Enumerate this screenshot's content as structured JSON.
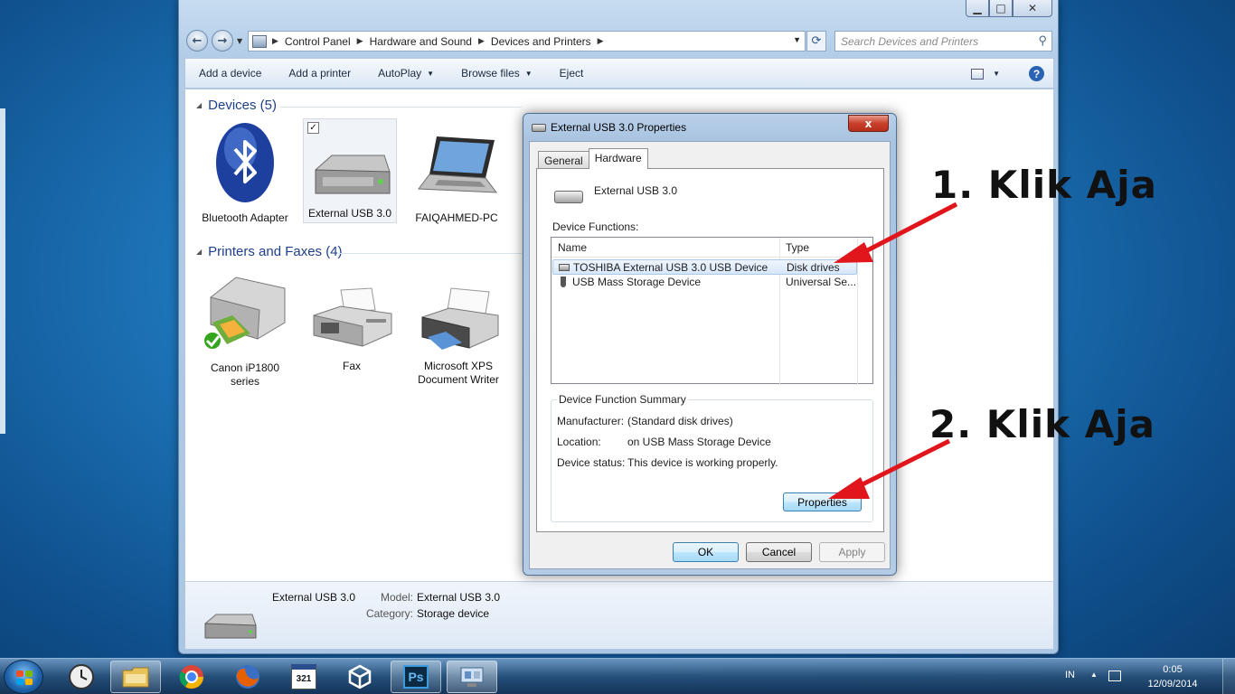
{
  "explorer": {
    "address": {
      "crumbs": [
        "Control Panel",
        "Hardware and Sound",
        "Devices and Printers"
      ]
    },
    "search_placeholder": "Search Devices and Printers",
    "toolbar": {
      "add_device": "Add a device",
      "add_printer": "Add a printer",
      "autoplay": "AutoPlay",
      "browse_files": "Browse files",
      "eject": "Eject"
    },
    "groups": {
      "devices": {
        "title": "Devices (5)",
        "items": [
          {
            "label": "Bluetooth Adapter",
            "icon": "bluetooth-icon"
          },
          {
            "label": "External USB 3.0",
            "icon": "external-drive-icon",
            "selected": true
          },
          {
            "label": "FAIQAHMED-PC",
            "icon": "laptop-icon"
          }
        ]
      },
      "printers": {
        "title": "Printers and Faxes (4)",
        "items": [
          {
            "label": "Canon iP1800 series",
            "icon": "printer-icon",
            "default": true
          },
          {
            "label": "Fax",
            "icon": "fax-icon"
          },
          {
            "label": "Microsoft XPS Document Writer",
            "icon": "printer-icon"
          }
        ]
      }
    },
    "details": {
      "name": "External USB 3.0",
      "model_label": "Model:",
      "model_value": "External USB 3.0",
      "category_label": "Category:",
      "category_value": "Storage device"
    }
  },
  "dialog": {
    "title": "External USB 3.0 Properties",
    "close": "x",
    "tabs": [
      "General",
      "Hardware"
    ],
    "device_name": "External USB 3.0",
    "functions_label": "Device Functions:",
    "columns": [
      "Name",
      "Type"
    ],
    "rows": [
      {
        "name": "TOSHIBA External USB 3.0 USB Device",
        "type": "Disk drives",
        "selected": true
      },
      {
        "name": "USB Mass Storage Device",
        "type": "Universal Se..."
      }
    ],
    "summary": {
      "legend": "Device Function Summary",
      "manufacturer_label": "Manufacturer:",
      "manufacturer_value": "(Standard disk drives)",
      "location_label": "Location:",
      "location_value": "on USB Mass Storage Device",
      "status_label": "Device status:",
      "status_value": "This device is working properly.",
      "properties_button": "Properties"
    },
    "buttons": {
      "ok": "OK",
      "cancel": "Cancel",
      "apply": "Apply"
    }
  },
  "annotations": {
    "step1": "1. Klik Aja",
    "step2": "2. Klik Aja",
    "arrow_color": "#e0161c"
  },
  "taskbar": {
    "apps": [
      "clock-icon",
      "explorer-folder-icon",
      "chrome-icon",
      "firefox-icon",
      "calendar-icon",
      "unity-icon",
      "photoshop-icon",
      "devices-printers-icon"
    ],
    "photoshop_label": "Ps",
    "calendar_label": "321",
    "lang": "IN",
    "time": "0:05",
    "date": "12/09/2014"
  }
}
